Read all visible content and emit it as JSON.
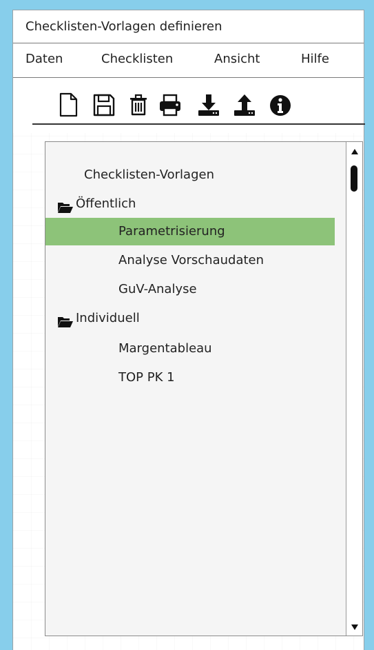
{
  "window": {
    "title": "Checklisten-Vorlagen definieren"
  },
  "menu": {
    "items": [
      "Daten",
      "Checklisten",
      "Ansicht",
      "Hilfe"
    ]
  },
  "toolbar": {
    "icons": [
      "new-document-icon",
      "save-icon",
      "delete-icon",
      "print-icon",
      "download-icon",
      "upload-icon",
      "info-icon"
    ]
  },
  "tree": {
    "root_label": "Checklisten-Vorlagen",
    "groups": [
      {
        "label": "Öffentlich",
        "icon": "folder-open-icon",
        "items": [
          "Parametrisierung",
          "Analyse Vorschaudaten",
          "GuV-Analyse"
        ]
      },
      {
        "label": "Individuell",
        "icon": "folder-open-icon",
        "items": [
          "Margentableau",
          "TOP PK 1"
        ]
      }
    ],
    "selected": "Parametrisierung",
    "selected_color": "#8dc379"
  }
}
